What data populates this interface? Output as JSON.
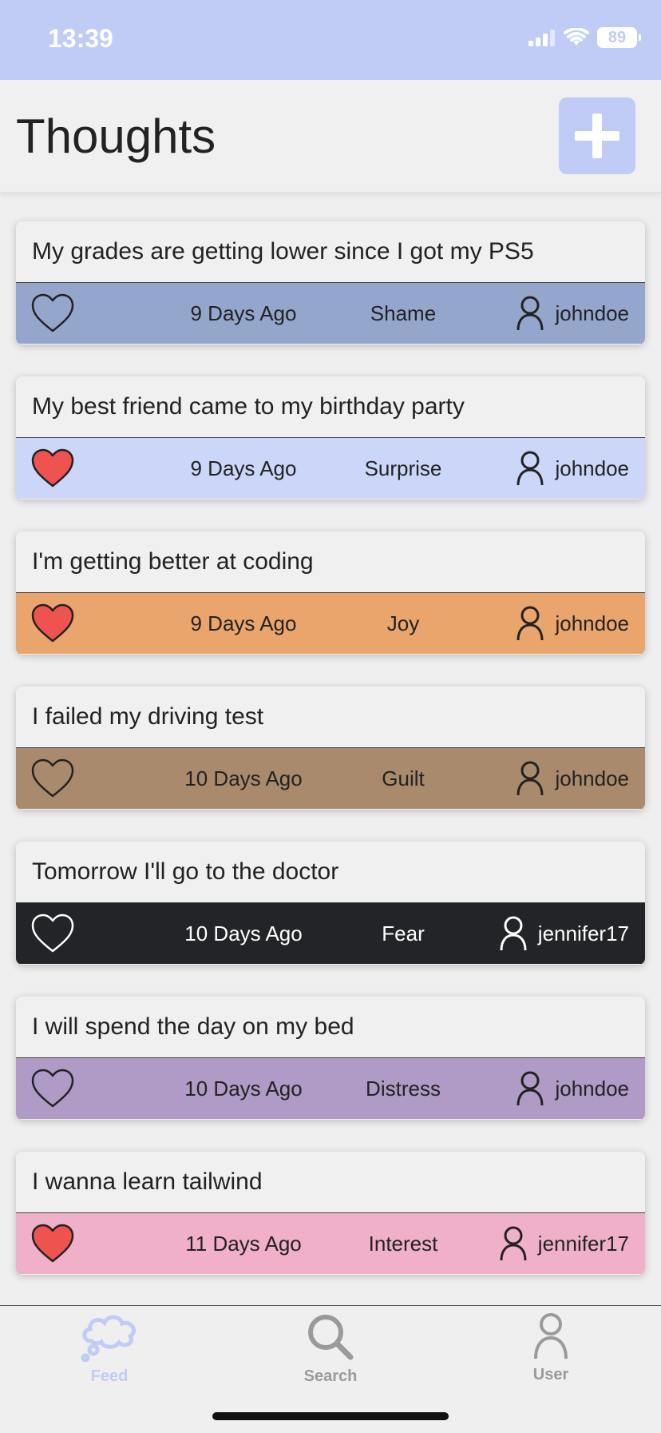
{
  "status_bar": {
    "time": "13:39",
    "battery": "89"
  },
  "header": {
    "title": "Thoughts",
    "add_icon": "plus-icon"
  },
  "thoughts": [
    {
      "text": "My grades are getting lower since I got my PS5",
      "time": "9 Days Ago",
      "emotion": "Shame",
      "user": "johndoe",
      "liked": false,
      "color": "#95a6cc",
      "text_color": "#222222"
    },
    {
      "text": "My best friend came to my birthday party",
      "time": "9 Days Ago",
      "emotion": "Surprise",
      "user": "johndoe",
      "liked": true,
      "color": "#cbd6f8",
      "text_color": "#222222"
    },
    {
      "text": "I'm getting better at coding",
      "time": "9 Days Ago",
      "emotion": "Joy",
      "user": "johndoe",
      "liked": true,
      "color": "#e9a56c",
      "text_color": "#222222"
    },
    {
      "text": "I failed my driving test",
      "time": "10 Days Ago",
      "emotion": "Guilt",
      "user": "johndoe",
      "liked": false,
      "color": "#a98a6c",
      "text_color": "#222222"
    },
    {
      "text": "Tomorrow I'll go to the doctor",
      "time": "10 Days Ago",
      "emotion": "Fear",
      "user": "jennifer17",
      "liked": false,
      "color": "#222428",
      "text_color": "#ffffff"
    },
    {
      "text": "I will spend the day on my bed",
      "time": "10 Days Ago",
      "emotion": "Distress",
      "user": "johndoe",
      "liked": false,
      "color": "#b09ac6",
      "text_color": "#222222"
    },
    {
      "text": "I wanna learn tailwind",
      "time": "11 Days Ago",
      "emotion": "Interest",
      "user": "jennifer17",
      "liked": true,
      "color": "#f1b0c9",
      "text_color": "#222222"
    }
  ],
  "tabs": [
    {
      "label": "Feed",
      "icon": "cloud-thought-icon",
      "active": true
    },
    {
      "label": "Search",
      "icon": "search-icon",
      "active": false
    },
    {
      "label": "User",
      "icon": "user-icon",
      "active": false
    }
  ],
  "colors": {
    "accent": "#c0ccf5",
    "heart_liked": "#ef5350",
    "tab_inactive": "#9a9a9a"
  }
}
